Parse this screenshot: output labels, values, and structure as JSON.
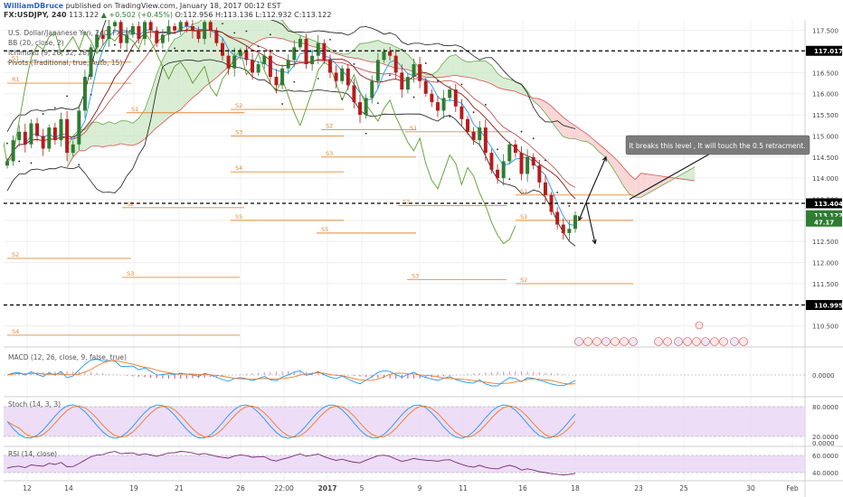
{
  "header": {
    "author": "WilliamDBruce",
    "published_text": "published on TradingView.com, January 18, 2017 00:12 EST",
    "symbol_line": "FX:USDJPY, 240",
    "last": "113.122",
    "change": "+0.502 (+0.45%)",
    "ohlc": "O:112.956 H:113.136 L:112.932 C:113.122"
  },
  "legend": {
    "title": "U.S. Dollar/Japanese Yen, 240, FXCM",
    "bb": "BB (20, close, 2)",
    "ichimoku": "Ichimoku (9, 26, 52, 26)",
    "pivots": "Pivots (Traditional, true, Auto, 15)",
    "macd": "MACD (12, 26, close, 9, false, true)",
    "stoch": "Stoch (14, 3, 3)",
    "rsi": "RSI (14, close)"
  },
  "annotation": "It breaks this level , It will touch the 0.5 retracment.",
  "colors": {
    "candle_up": "#2e7d32",
    "candle_down": "#b71c1c",
    "bb": "#1a1a1a",
    "tenkan": "#2196f3",
    "kijun": "#8b1a1a",
    "chikou": "#5a9e2a",
    "cloud_bull": "#c8e6c0",
    "cloud_bear": "#f6c6c6",
    "pivot": "#e08a3a",
    "macd": "#2196f3",
    "signal": "#e87a2a",
    "rsi": "#7b2a7b",
    "osc_band": "#e8d4f4"
  },
  "chart_data": {
    "type": "candlestick",
    "symbol": "FX:USDJPY",
    "timeframe": "240",
    "y_range": [
      110.0,
      117.75
    ],
    "y_ticks": [
      "117.500",
      "117.000",
      "116.500",
      "116.000",
      "115.500",
      "115.000",
      "114.500",
      "114.000",
      "113.500",
      "113.000",
      "112.500",
      "112.000",
      "111.500",
      "111.000",
      "110.500"
    ],
    "x_ticks": [
      "12",
      "14",
      "19",
      "21",
      "26",
      "22:00",
      "2017",
      "5",
      "9",
      "11",
      "16",
      "18",
      "23",
      "25",
      "30",
      "Feb"
    ],
    "price_tags": [
      {
        "label": "117.017",
        "value": 117.017
      },
      {
        "label": "113.404",
        "value": 113.404
      },
      {
        "label": "113.122",
        "value": 113.122
      },
      {
        "label": "47.17",
        "value": 112.97
      },
      {
        "label": "110.995",
        "value": 110.995
      }
    ],
    "horizontal_levels": [
      117.017,
      113.404,
      110.995
    ],
    "closes": [
      114.4,
      114.9,
      115.1,
      114.8,
      115.3,
      115.0,
      114.7,
      115.2,
      114.9,
      115.4,
      114.6,
      114.8,
      115.6,
      116.4,
      117.1,
      117.4,
      117.3,
      117.6,
      117.7,
      117.2,
      117.4,
      117.6,
      117.3,
      117.7,
      117.5,
      117.2,
      117.4,
      117.6,
      117.5,
      117.7,
      117.6,
      117.5,
      117.3,
      117.7,
      117.5,
      117.2,
      116.9,
      116.6,
      116.9,
      117.0,
      116.8,
      116.5,
      116.7,
      116.9,
      116.4,
      116.2,
      116.6,
      116.8,
      117.1,
      117.3,
      116.7,
      116.9,
      117.2,
      116.8,
      116.5,
      116.3,
      116.6,
      116.2,
      115.8,
      115.5,
      115.9,
      116.3,
      116.8,
      117.0,
      116.9,
      116.5,
      116.1,
      116.4,
      116.7,
      116.3,
      116.0,
      115.8,
      115.6,
      115.9,
      116.1,
      115.7,
      115.4,
      115.1,
      114.9,
      115.2,
      114.6,
      114.2,
      114.0,
      114.4,
      114.8,
      114.6,
      114.1,
      114.5,
      114.3,
      113.9,
      113.6,
      113.2,
      112.9,
      112.7,
      112.8,
      113.122
    ],
    "pivot_labels": [
      {
        "label": "R1",
        "value": 116.25
      },
      {
        "label": "S1",
        "value": 116.75
      },
      {
        "label": "S1",
        "value": 115.55
      },
      {
        "label": "S2",
        "value": 115.63
      },
      {
        "label": "S3",
        "value": 115.0
      },
      {
        "label": "S2",
        "value": 115.15
      },
      {
        "label": "S1",
        "value": 115.1
      },
      {
        "label": "S3",
        "value": 114.5
      },
      {
        "label": "S4",
        "value": 114.15
      },
      {
        "label": "S1",
        "value": 113.6
      },
      {
        "label": "S2",
        "value": 113.35
      },
      {
        "label": "S2",
        "value": 113.3
      },
      {
        "label": "S5",
        "value": 113.0
      },
      {
        "label": "S1",
        "value": 113.0
      },
      {
        "label": "S5",
        "value": 112.7
      },
      {
        "label": "S2",
        "value": 112.1
      },
      {
        "label": "S3",
        "value": 111.65
      },
      {
        "label": "S3",
        "value": 111.6
      },
      {
        "label": "S2",
        "value": 111.5
      },
      {
        "label": "S4",
        "value": 110.28
      }
    ],
    "macd_ticks": [
      "0.0000"
    ],
    "stoch_ticks": [
      "80.0000",
      "20.0000"
    ],
    "stoch_overlap_tick": "0.0000",
    "rsi_ticks": [
      "60.0000",
      "40.0000"
    ]
  }
}
